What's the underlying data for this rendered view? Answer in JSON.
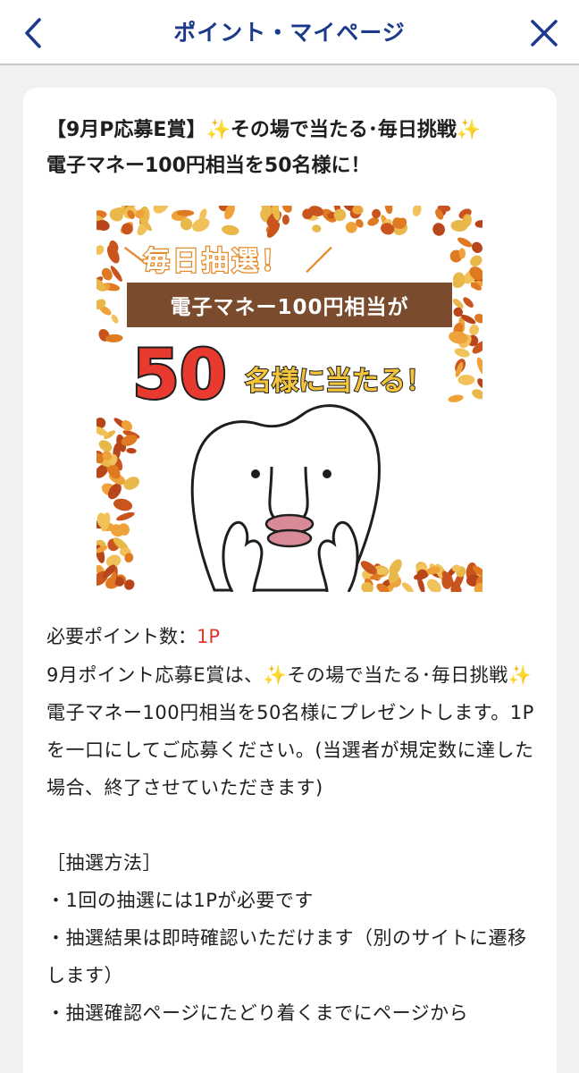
{
  "header": {
    "title": "ポイント・マイページ",
    "back_icon": "chevron-left-icon",
    "close_icon": "close-icon",
    "accent_color": "#1c3a8c"
  },
  "card": {
    "title_prefix": "【9月P応募E賞】",
    "sparkle": "✨",
    "title_mid": "その場で当たる･毎日挑戦",
    "title_line2": "電子マネー100円相当を50名様に！",
    "banner": {
      "tag": "毎日抽選！",
      "headline": "電子マネー100円相当が",
      "big_number": "50",
      "suffix": "名様に当たる！"
    },
    "points_label": "必要ポイント数：",
    "points_value": "1P",
    "desc_a": "9月ポイント応募E賞は、",
    "desc_b": "その場で当たる･毎日挑戦",
    "desc_c": "電子マネー100円相当を50名様にプレゼントします。1Pを一口にしてご応募ください。(当選者が規定数に達した場合、終了させていただきます)",
    "method_heading": "［抽選方法］",
    "method_items": [
      "・1回の抽選には1Pが必要です",
      "・抽選結果は即時確認いただけます（別のサイトに遷移します）",
      "・抽選確認ページにたどり着くまでにページから"
    ]
  }
}
